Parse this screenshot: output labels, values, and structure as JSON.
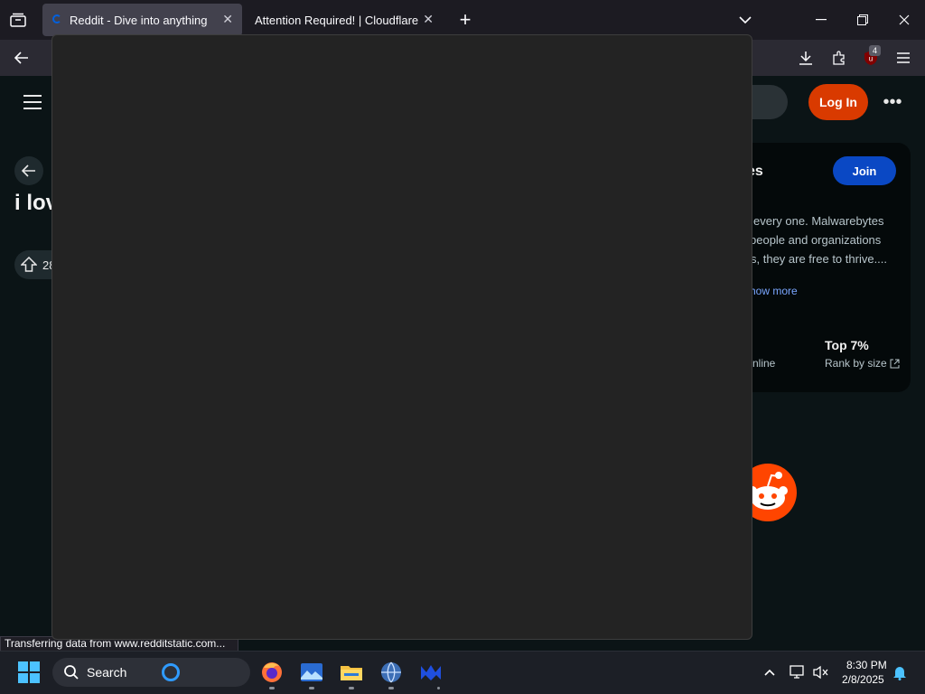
{
  "browser": {
    "tabs": [
      {
        "label": "Reddit - Dive into anything",
        "active": true
      },
      {
        "label": "Attention Required! | Cloudflare",
        "active": false
      }
    ],
    "badge_count": "4"
  },
  "reddit": {
    "login_label": "Log In",
    "join_label": "Join",
    "post_title_fragment": "i lov",
    "vote_fragment": "28",
    "sidebar": {
      "heading_fragment": "es",
      "desc_line1": "every one. Malwarebytes",
      "desc_line2": "people and organizations",
      "desc_line3": "s, they are free to thrive....",
      "show_more": "how more",
      "online_fragment": "nline",
      "rank_value": "Top 7%",
      "rank_label": "Rank by size"
    }
  },
  "status": {
    "text": "Transferring data from www.redditstatic.com..."
  },
  "taskbar": {
    "search_label": "Search",
    "time": "8:30 PM",
    "date": "2/8/2025"
  },
  "colors": {
    "reddit_orange": "#d93a00",
    "join_blue": "#0a48c4",
    "page_bg": "#0b1416"
  }
}
